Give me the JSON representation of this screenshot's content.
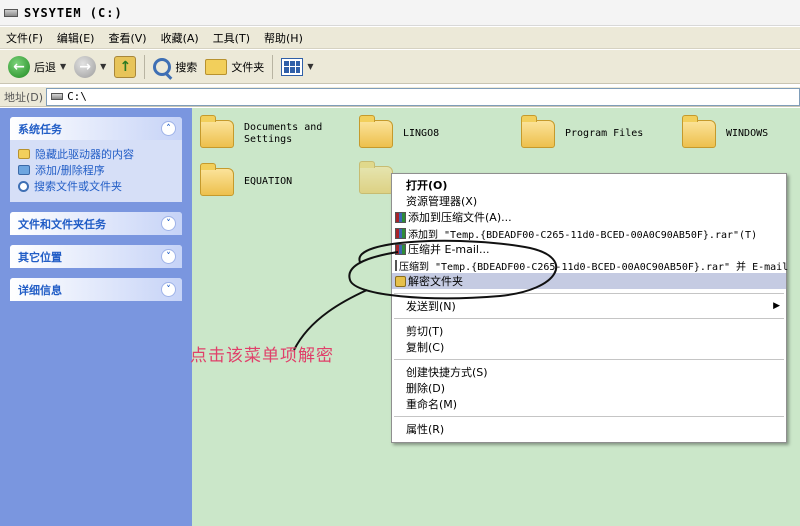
{
  "window": {
    "title": "SYSYTEM (C:)"
  },
  "menubar": [
    "文件(F)",
    "编辑(E)",
    "查看(V)",
    "收藏(A)",
    "工具(T)",
    "帮助(H)"
  ],
  "toolbar": {
    "back": "后退",
    "search": "搜索",
    "folders": "文件夹"
  },
  "address": {
    "label": "地址(D)",
    "value": "C:\\"
  },
  "sidebar": {
    "system_tasks": {
      "title": "系统任务",
      "items": [
        "隐藏此驱动器的内容",
        "添加/删除程序",
        "搜索文件或文件夹"
      ]
    },
    "file_tasks": "文件和文件夹任务",
    "other_places": "其它位置",
    "details": "详细信息"
  },
  "folders": [
    {
      "name": "Documents and Settings"
    },
    {
      "name": "LINGO8"
    },
    {
      "name": "Program Files"
    },
    {
      "name": "WINDOWS"
    },
    {
      "name": "EQUATION"
    }
  ],
  "context_menu": {
    "open": "打开(O)",
    "explorer": "资源管理器(X)",
    "add_archive": "添加到压缩文件(A)...",
    "add_rar": "添加到 \"Temp.{BDEADF00-C265-11d0-BCED-00A0C90AB50F}.rar\"(T)",
    "compress_email": "压缩并 E-mail...",
    "compress_rar_email": "压缩到 \"Temp.{BDEADF00-C265-11d0-BCED-00A0C90AB50F}.rar\" 并 E-mail",
    "decrypt": "解密文件夹",
    "send_to": "发送到(N)",
    "cut": "剪切(T)",
    "copy": "复制(C)",
    "shortcut": "创建快捷方式(S)",
    "delete": "删除(D)",
    "rename": "重命名(M)",
    "properties": "属性(R)"
  },
  "annotation": {
    "text": "点击该菜单项解密",
    "color": "#e0406a"
  },
  "colors": {
    "sidebar_bg": "#7a96df",
    "main_bg": "#cbe7c9",
    "menu_highlight": "#c5cbe2"
  }
}
